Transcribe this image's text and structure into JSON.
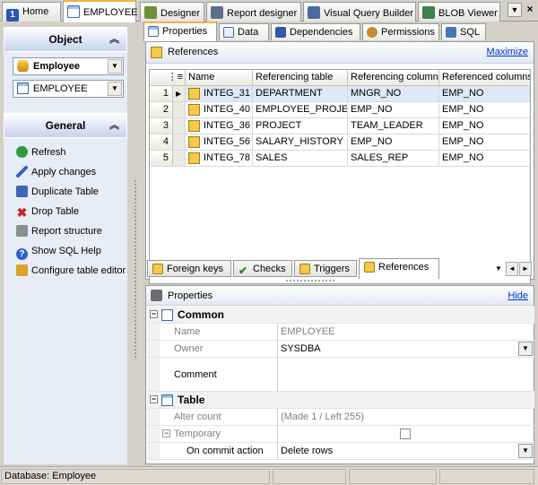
{
  "top_tabs": [
    {
      "label": "Home",
      "icon": "home-icon"
    },
    {
      "label": "EMPLOYEE",
      "icon": "table-icon"
    },
    {
      "label": "Designer",
      "icon": "designer-icon"
    },
    {
      "label": "Report designer",
      "icon": "report-designer-icon"
    },
    {
      "label": "Visual Query Builder",
      "icon": "query-builder-icon"
    },
    {
      "label": "BLOB Viewer",
      "icon": "blob-viewer-icon"
    }
  ],
  "left": {
    "object_header": "Object",
    "database_combo": "Employee",
    "table_combo": "EMPLOYEE",
    "general_header": "General",
    "actions": [
      {
        "label": "Refresh",
        "icon": "refresh-icon"
      },
      {
        "label": "Apply changes",
        "icon": "apply-changes-icon"
      },
      {
        "label": "Duplicate Table",
        "icon": "duplicate-table-icon"
      },
      {
        "label": "Drop Table",
        "icon": "drop-table-icon"
      },
      {
        "label": "Report structure",
        "icon": "printer-icon"
      },
      {
        "label": "Show SQL Help",
        "icon": "help-icon"
      },
      {
        "label": "Configure table editor",
        "icon": "configure-icon"
      }
    ]
  },
  "panel_tabs": [
    "Properties",
    "Data",
    "Dependencies",
    "Permissions",
    "SQL"
  ],
  "references": {
    "title": "References",
    "maximize_link": "Maximize",
    "columns": [
      "Name",
      "Referencing table",
      "Referencing columns",
      "Referenced columns"
    ],
    "rows": [
      {
        "num": "1",
        "name": "INTEG_31",
        "ref_table": "DEPARTMENT",
        "ref_cols": "MNGR_NO",
        "refd_cols": "EMP_NO"
      },
      {
        "num": "2",
        "name": "INTEG_40",
        "ref_table": "EMPLOYEE_PROJECT",
        "ref_cols": "EMP_NO",
        "refd_cols": "EMP_NO"
      },
      {
        "num": "3",
        "name": "INTEG_36",
        "ref_table": "PROJECT",
        "ref_cols": "TEAM_LEADER",
        "refd_cols": "EMP_NO"
      },
      {
        "num": "4",
        "name": "INTEG_56",
        "ref_table": "SALARY_HISTORY",
        "ref_cols": "EMP_NO",
        "refd_cols": "EMP_NO"
      },
      {
        "num": "5",
        "name": "INTEG_78",
        "ref_table": "SALES",
        "ref_cols": "SALES_REP",
        "refd_cols": "EMP_NO"
      }
    ]
  },
  "bottom_tabs": [
    "Foreign keys",
    "Checks",
    "Triggers",
    "References"
  ],
  "properties": {
    "title": "Properties",
    "hide_link": "Hide",
    "common_header": "Common",
    "name_label": "Name",
    "name_value": "EMPLOYEE",
    "owner_label": "Owner",
    "owner_value": "SYSDBA",
    "comment_label": "Comment",
    "comment_value": "",
    "table_header": "Table",
    "alter_label": "Alter count",
    "alter_value": "(Made 1 / Left 255)",
    "temporary_label": "Temporary",
    "commit_label": "On commit action",
    "commit_value": "Delete rows"
  },
  "status": {
    "database": "Database: Employee"
  }
}
